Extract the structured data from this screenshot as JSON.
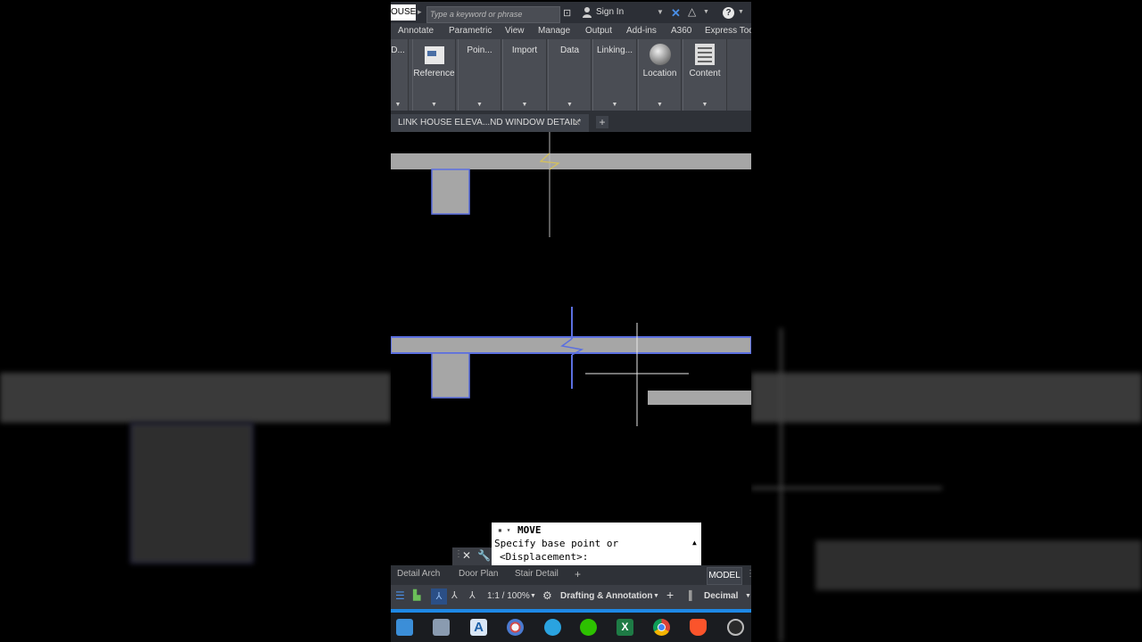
{
  "title_bar": {
    "doc_label": "OUSE...",
    "search_placeholder": "Type a keyword or phrase",
    "signin_label": "Sign In",
    "help_glyph": "?"
  },
  "menu": {
    "items": [
      "Annotate",
      "Parametric",
      "View",
      "Manage",
      "Output",
      "Add-ins",
      "A360",
      "Express Too"
    ]
  },
  "ribbon": {
    "partial_label": "D...",
    "buttons": [
      "Reference",
      "Poin...",
      "Import",
      "Data",
      "Linking...",
      "Location",
      "Content"
    ]
  },
  "doc_tab": {
    "label": "LINK HOUSE ELEVA...ND WINDOW DETAIL*"
  },
  "command_line": {
    "command": "MOVE",
    "prompt_line1": "Specify base point or",
    "prompt_line2": "<Displacement>:"
  },
  "layout_tabs": {
    "tabs": [
      "Detail Arch",
      "Door Plan",
      "Stair Detail"
    ],
    "model_label": "MODEL"
  },
  "status_bar": {
    "scale": "1:1 / 100%",
    "workspace": "Drafting & Annotation",
    "units": "Decimal"
  },
  "colors": {
    "accent_blue": "#1e88e5",
    "beam_gray": "#a6a6a6",
    "selection_blue": "#5b6fe0",
    "break_yellow": "#d6c25a"
  },
  "taskbar_icons": [
    "file-explorer-icon",
    "files-icon",
    "autocad-icon",
    "paint-icon",
    "telegram-icon",
    "wechat-icon",
    "excel-icon",
    "chrome-icon",
    "brave-icon",
    "obs-icon"
  ]
}
